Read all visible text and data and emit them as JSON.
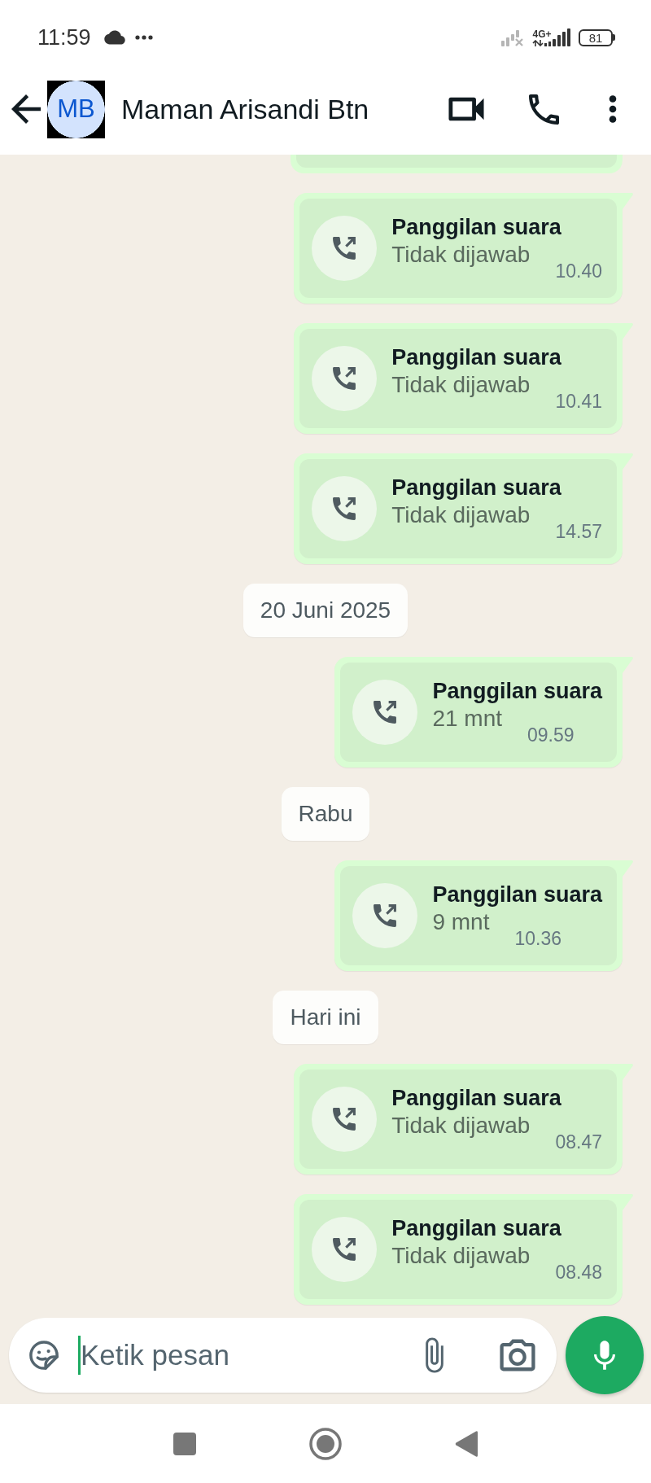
{
  "status_bar": {
    "time": "11:59",
    "network": "4G+",
    "battery": "81"
  },
  "header": {
    "avatar_initials": "MB",
    "contact_name": "Maman Arisandi Btn"
  },
  "messages": [
    {
      "kind": "clipped"
    },
    {
      "kind": "call",
      "title": "Panggilan suara",
      "detail": "Tidak dijawab",
      "time": "10.40"
    },
    {
      "kind": "call",
      "title": "Panggilan suara",
      "detail": "Tidak dijawab",
      "time": "10.41"
    },
    {
      "kind": "call",
      "title": "Panggilan suara",
      "detail": "Tidak dijawab",
      "time": "14.57"
    },
    {
      "kind": "date",
      "label": "20 Juni 2025"
    },
    {
      "kind": "call",
      "title": "Panggilan suara",
      "detail": "21 mnt",
      "time": "09.59"
    },
    {
      "kind": "date",
      "label": "Rabu"
    },
    {
      "kind": "call",
      "title": "Panggilan suara",
      "detail": "9 mnt",
      "time": "10.36"
    },
    {
      "kind": "date",
      "label": "Hari ini"
    },
    {
      "kind": "call",
      "title": "Panggilan suara",
      "detail": "Tidak dijawab",
      "time": "08.47"
    },
    {
      "kind": "call",
      "title": "Panggilan suara",
      "detail": "Tidak dijawab",
      "time": "08.48"
    }
  ],
  "composer": {
    "placeholder": "Ketik pesan",
    "focused": true
  }
}
